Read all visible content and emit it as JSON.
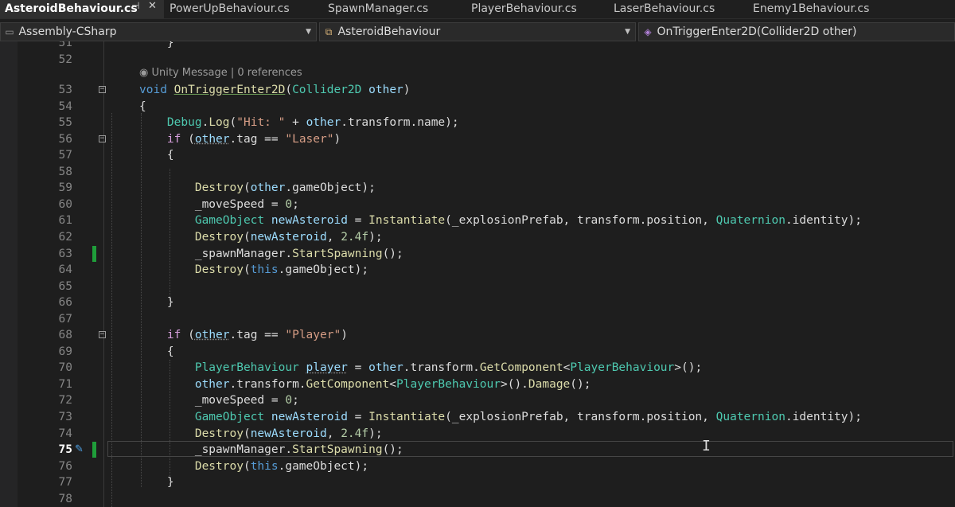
{
  "tabs": [
    {
      "label": "AsteroidBehaviour.cs",
      "active": true,
      "pin": "⊣",
      "close": "✕"
    },
    {
      "label": "PowerUpBehaviour.cs"
    },
    {
      "label": "SpawnManager.cs"
    },
    {
      "label": "PlayerBehaviour.cs"
    },
    {
      "label": "LaserBehaviour.cs"
    },
    {
      "label": "Enemy1Behaviour.cs"
    }
  ],
  "navbar": {
    "project": "Assembly-CSharp",
    "class": "AsteroidBehaviour",
    "member": "OnTriggerEnter2D(Collider2D other)"
  },
  "codelens": {
    "message": "Unity Message",
    "separator": " | ",
    "references": "0 references"
  },
  "current_line": "75",
  "line_numbers": [
    "51",
    "52",
    "53",
    "54",
    "55",
    "56",
    "57",
    "58",
    "59",
    "60",
    "61",
    "62",
    "63",
    "64",
    "65",
    "66",
    "67",
    "68",
    "69",
    "70",
    "71",
    "72",
    "73",
    "74",
    "75",
    "76",
    "77",
    "78"
  ],
  "code": [
    {
      "ln": "51",
      "t": [
        [
          "c",
          "    }"
        ]
      ]
    },
    {
      "ln": "52",
      "t": []
    },
    {
      "ln": "53",
      "t": [
        [
          "kw",
          "void"
        ],
        [
          "c",
          " "
        ],
        [
          "fnu",
          "OnTriggerEnter2D"
        ],
        [
          "c",
          "("
        ],
        [
          "tp",
          "Collider2D"
        ],
        [
          "c",
          " "
        ],
        [
          "pr",
          "other"
        ],
        [
          "c",
          ")"
        ]
      ]
    },
    {
      "ln": "54",
      "t": [
        [
          "c",
          "{"
        ]
      ]
    },
    {
      "ln": "55",
      "t": [
        [
          "c",
          "    "
        ],
        [
          "tp",
          "Debug"
        ],
        [
          "c",
          "."
        ],
        [
          "fn",
          "Log"
        ],
        [
          "c",
          "("
        ],
        [
          "st",
          "\"Hit: \""
        ],
        [
          "c",
          " + "
        ],
        [
          "pr",
          "other"
        ],
        [
          "c",
          ".transform.name);"
        ]
      ]
    },
    {
      "ln": "56",
      "t": [
        [
          "c",
          "    "
        ],
        [
          "cf",
          "if"
        ],
        [
          "c",
          " ("
        ],
        [
          "pru",
          "other"
        ],
        [
          "c",
          ".tag == "
        ],
        [
          "st",
          "\"Laser\""
        ],
        [
          "c",
          ")"
        ]
      ]
    },
    {
      "ln": "57",
      "t": [
        [
          "c",
          "    {"
        ]
      ]
    },
    {
      "ln": "58",
      "t": []
    },
    {
      "ln": "59",
      "t": [
        [
          "c",
          "        "
        ],
        [
          "fn",
          "Destroy"
        ],
        [
          "c",
          "("
        ],
        [
          "pr",
          "other"
        ],
        [
          "c",
          ".gameObject);"
        ]
      ]
    },
    {
      "ln": "60",
      "t": [
        [
          "c",
          "        _moveSpeed = "
        ],
        [
          "nm",
          "0"
        ],
        [
          "c",
          ";"
        ]
      ]
    },
    {
      "ln": "61",
      "t": [
        [
          "c",
          "        "
        ],
        [
          "tp",
          "GameObject"
        ],
        [
          "c",
          " "
        ],
        [
          "pr",
          "newAsteroid"
        ],
        [
          "c",
          " = "
        ],
        [
          "fn",
          "Instantiate"
        ],
        [
          "c",
          "(_explosionPrefab, transform.position, "
        ],
        [
          "tp",
          "Quaternion"
        ],
        [
          "c",
          ".identity);"
        ]
      ]
    },
    {
      "ln": "62",
      "t": [
        [
          "c",
          "        "
        ],
        [
          "fn",
          "Destroy"
        ],
        [
          "c",
          "("
        ],
        [
          "pr",
          "newAsteroid"
        ],
        [
          "c",
          ", "
        ],
        [
          "nm",
          "2.4f"
        ],
        [
          "c",
          ");"
        ]
      ]
    },
    {
      "ln": "63",
      "t": [
        [
          "c",
          "        _spawnManager."
        ],
        [
          "fn",
          "StartSpawning"
        ],
        [
          "c",
          "();"
        ]
      ]
    },
    {
      "ln": "64",
      "t": [
        [
          "c",
          "        "
        ],
        [
          "fn",
          "Destroy"
        ],
        [
          "c",
          "("
        ],
        [
          "kw",
          "this"
        ],
        [
          "c",
          ".gameObject);"
        ]
      ]
    },
    {
      "ln": "65",
      "t": []
    },
    {
      "ln": "66",
      "t": [
        [
          "c",
          "    }"
        ]
      ]
    },
    {
      "ln": "67",
      "t": []
    },
    {
      "ln": "68",
      "t": [
        [
          "c",
          "    "
        ],
        [
          "cf",
          "if"
        ],
        [
          "c",
          " ("
        ],
        [
          "pru",
          "other"
        ],
        [
          "c",
          ".tag == "
        ],
        [
          "st",
          "\"Player\""
        ],
        [
          "c",
          ")"
        ]
      ]
    },
    {
      "ln": "69",
      "t": [
        [
          "c",
          "    {"
        ]
      ]
    },
    {
      "ln": "70",
      "t": [
        [
          "c",
          "        "
        ],
        [
          "tp",
          "PlayerBehaviour"
        ],
        [
          "c",
          " "
        ],
        [
          "pru",
          "player"
        ],
        [
          "c",
          " = "
        ],
        [
          "pr",
          "other"
        ],
        [
          "c",
          ".transform."
        ],
        [
          "fn",
          "GetComponent"
        ],
        [
          "c",
          "<"
        ],
        [
          "tp",
          "PlayerBehaviour"
        ],
        [
          "c",
          ">();"
        ]
      ]
    },
    {
      "ln": "71",
      "t": [
        [
          "c",
          "        "
        ],
        [
          "pr",
          "other"
        ],
        [
          "c",
          ".transform."
        ],
        [
          "fn",
          "GetComponent"
        ],
        [
          "c",
          "<"
        ],
        [
          "tp",
          "PlayerBehaviour"
        ],
        [
          "c",
          ">()."
        ],
        [
          "fn",
          "Damage"
        ],
        [
          "c",
          "();"
        ]
      ]
    },
    {
      "ln": "72",
      "t": [
        [
          "c",
          "        _moveSpeed = "
        ],
        [
          "nm",
          "0"
        ],
        [
          "c",
          ";"
        ]
      ]
    },
    {
      "ln": "73",
      "t": [
        [
          "c",
          "        "
        ],
        [
          "tp",
          "GameObject"
        ],
        [
          "c",
          " "
        ],
        [
          "pr",
          "newAsteroid"
        ],
        [
          "c",
          " = "
        ],
        [
          "fn",
          "Instantiate"
        ],
        [
          "c",
          "(_explosionPrefab, transform.position, "
        ],
        [
          "tp",
          "Quaternion"
        ],
        [
          "c",
          ".identity);"
        ]
      ]
    },
    {
      "ln": "74",
      "t": [
        [
          "c",
          "        "
        ],
        [
          "fn",
          "Destroy"
        ],
        [
          "c",
          "("
        ],
        [
          "pr",
          "newAsteroid"
        ],
        [
          "c",
          ", "
        ],
        [
          "nm",
          "2.4f"
        ],
        [
          "c",
          ");"
        ]
      ]
    },
    {
      "ln": "75",
      "t": [
        [
          "c",
          "        _spawnManager."
        ],
        [
          "fn",
          "StartSpawning"
        ],
        [
          "c",
          "();"
        ]
      ]
    },
    {
      "ln": "76",
      "t": [
        [
          "c",
          "        "
        ],
        [
          "fn",
          "Destroy"
        ],
        [
          "c",
          "("
        ],
        [
          "kw",
          "this"
        ],
        [
          "c",
          ".gameObject);"
        ]
      ]
    },
    {
      "ln": "77",
      "t": [
        [
          "c",
          "    }"
        ]
      ]
    },
    {
      "ln": "78",
      "t": []
    }
  ],
  "colors": {
    "keyword": "#569cd6",
    "control": "#d8a0df",
    "type": "#4ec9b0",
    "method": "#dcdcaa",
    "string": "#d69d85",
    "number": "#b5cea8",
    "param": "#9cdcfe",
    "change_marker": "#1f9e3a"
  },
  "icons": {
    "project": "csharp-project-icon",
    "class": "class-icon",
    "member": "method-icon",
    "codelens": "unity-icon",
    "quick_action": "screwdriver-icon"
  }
}
